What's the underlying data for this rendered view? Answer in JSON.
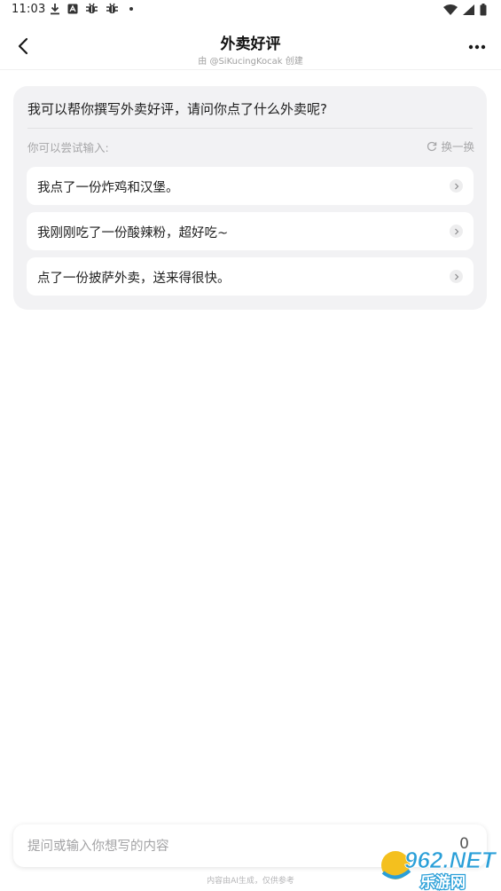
{
  "status_bar": {
    "time": "11:03",
    "left_icons": [
      "download-icon",
      "app-notification-icon",
      "bug-icon",
      "bug-icon",
      "dot"
    ],
    "right_icons": [
      "wifi-icon",
      "signal-icon",
      "battery-icon"
    ]
  },
  "header": {
    "title": "外卖好评",
    "subtitle": "由 @SiKucingKocak 创建"
  },
  "card": {
    "welcome": "我可以帮你撰写外卖好评，请问你点了什么外卖呢?",
    "try_label": "你可以尝试输入:",
    "refresh_label": "换一换",
    "suggestions": [
      "我点了一份炸鸡和汉堡。",
      "我刚刚吃了一份酸辣粉，超好吃~",
      "点了一份披萨外卖，送来得很快。"
    ]
  },
  "input": {
    "placeholder": "提问或输入你想写的内容",
    "char_count": "0"
  },
  "disclaimer": "内容由AI生成，仅供参考",
  "watermark": {
    "top": "962.NET",
    "bottom": "乐游网"
  },
  "colors": {
    "card_bg": "#f2f2f4",
    "muted_text": "#a6a6a8",
    "watermark_blue": "#2a9fd8",
    "watermark_yellow": "#f4c01e"
  }
}
